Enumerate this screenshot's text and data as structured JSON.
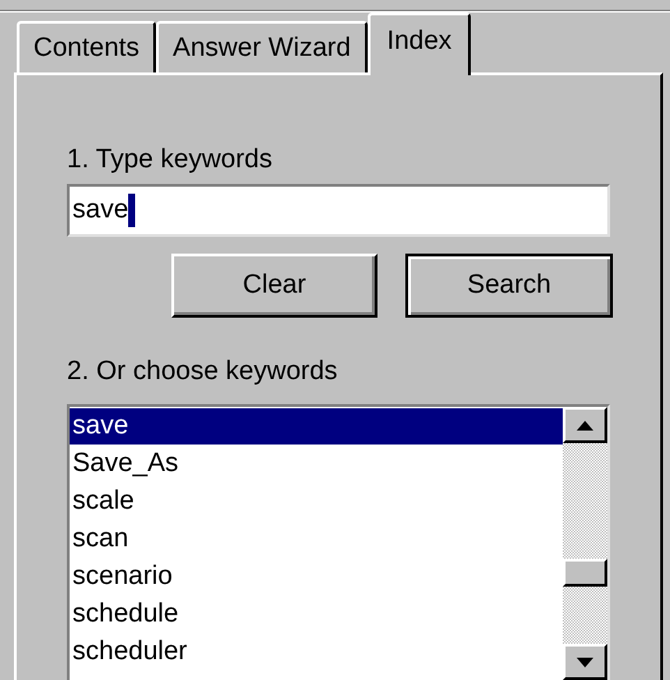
{
  "tabs": [
    {
      "label": "Contents",
      "selected": false
    },
    {
      "label": "Answer Wizard",
      "selected": false
    },
    {
      "label": "Index",
      "selected": true
    }
  ],
  "type_keywords": {
    "label": "1. Type keywords",
    "value": "save"
  },
  "buttons": [
    {
      "label": "Clear",
      "default": false
    },
    {
      "label": "Search",
      "default": true
    }
  ],
  "choose_keywords": {
    "label": "2. Or choose keywords",
    "items": [
      {
        "label": "save",
        "selected": true
      },
      {
        "label": "Save_As",
        "selected": false
      },
      {
        "label": "scale",
        "selected": false
      },
      {
        "label": "scan",
        "selected": false
      },
      {
        "label": "scenario",
        "selected": false
      },
      {
        "label": "schedule",
        "selected": false
      },
      {
        "label": "scheduler",
        "selected": false
      }
    ]
  }
}
